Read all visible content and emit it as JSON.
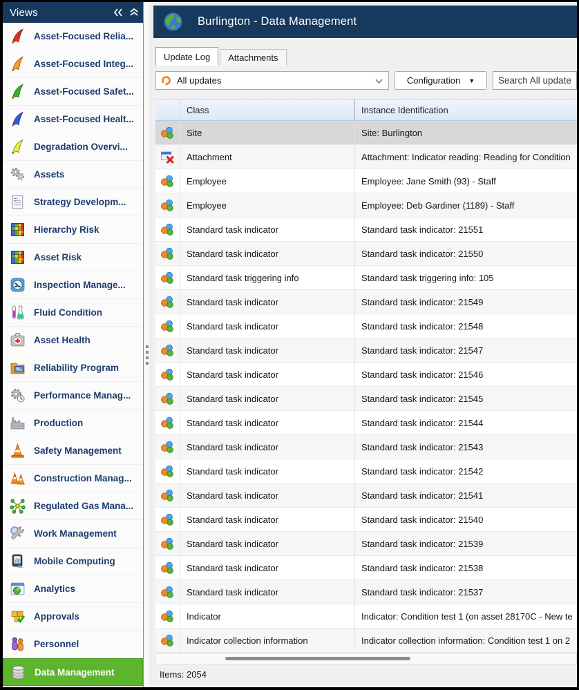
{
  "sidebar": {
    "header": {
      "title": "Views"
    },
    "items": [
      {
        "icon": "flag-red",
        "label": "Asset-Focused Relia...",
        "selected": false
      },
      {
        "icon": "flag-orange",
        "label": "Asset-Focused Integ...",
        "selected": false
      },
      {
        "icon": "flag-green",
        "label": "Asset-Focused Safet...",
        "selected": false
      },
      {
        "icon": "flag-blue",
        "label": "Asset-Focused Healt...",
        "selected": false
      },
      {
        "icon": "flag-yellow",
        "label": "Degradation Overvi...",
        "selected": false
      },
      {
        "icon": "gears",
        "label": "Assets",
        "selected": false
      },
      {
        "icon": "document",
        "label": "Strategy Developm...",
        "selected": false
      },
      {
        "icon": "risk-grid",
        "label": "Hierarchy Risk",
        "selected": false
      },
      {
        "icon": "risk-grid",
        "label": "Asset Risk",
        "selected": false
      },
      {
        "icon": "gauge",
        "label": "Inspection Manage...",
        "selected": false
      },
      {
        "icon": "test-tubes",
        "label": "Fluid Condition",
        "selected": false
      },
      {
        "icon": "first-aid",
        "label": "Asset Health",
        "selected": false
      },
      {
        "icon": "folder",
        "label": "Reliability Program",
        "selected": false
      },
      {
        "icon": "perf-gears",
        "label": "Performance Manag...",
        "selected": false
      },
      {
        "icon": "factory",
        "label": "Production",
        "selected": false
      },
      {
        "icon": "cone",
        "label": "Safety Management",
        "selected": false
      },
      {
        "icon": "cones",
        "label": "Construction Manag...",
        "selected": false
      },
      {
        "icon": "molecule",
        "label": "Regulated Gas Mana...",
        "selected": false
      },
      {
        "icon": "tools",
        "label": "Work Management",
        "selected": false
      },
      {
        "icon": "mobile",
        "label": "Mobile Computing",
        "selected": false
      },
      {
        "icon": "analytics",
        "label": "Analytics",
        "selected": false
      },
      {
        "icon": "approvals",
        "label": "Approvals",
        "selected": false
      },
      {
        "icon": "personnel",
        "label": "Personnel",
        "selected": false
      },
      {
        "icon": "database",
        "label": "Data Management",
        "selected": true
      }
    ]
  },
  "main": {
    "header": {
      "title": "Burlington - Data Management"
    },
    "tabs": [
      {
        "label": "Update Log",
        "active": true
      },
      {
        "label": "Attachments",
        "active": false
      }
    ],
    "toolbar": {
      "filter_value": "All updates",
      "configuration_label": "Configuration",
      "search_placeholder": "Search All updates"
    },
    "table": {
      "columns": [
        "Class",
        "Instance Identification"
      ],
      "rows": [
        {
          "icon": "class-balls",
          "class": "Site",
          "instance": "Site: Burlington",
          "selected": true
        },
        {
          "icon": "attachment",
          "class": "Attachment",
          "instance": "Attachment: Indicator reading: Reading for Condition",
          "selected": false
        },
        {
          "icon": "class-balls",
          "class": "Employee",
          "instance": "Employee: Jane Smith  (93) - Staff",
          "selected": false
        },
        {
          "icon": "class-balls",
          "class": "Employee",
          "instance": "Employee: Deb Gardiner  (1189) - Staff",
          "selected": false
        },
        {
          "icon": "class-balls",
          "class": "Standard task indicator",
          "instance": "Standard task indicator: 21551",
          "selected": false
        },
        {
          "icon": "class-balls",
          "class": "Standard task indicator",
          "instance": "Standard task indicator: 21550",
          "selected": false
        },
        {
          "icon": "class-balls",
          "class": "Standard task triggering info",
          "instance": "Standard task triggering info: 105",
          "selected": false
        },
        {
          "icon": "class-balls",
          "class": "Standard task indicator",
          "instance": "Standard task indicator: 21549",
          "selected": false
        },
        {
          "icon": "class-balls",
          "class": "Standard task indicator",
          "instance": "Standard task indicator: 21548",
          "selected": false
        },
        {
          "icon": "class-balls",
          "class": "Standard task indicator",
          "instance": "Standard task indicator: 21547",
          "selected": false
        },
        {
          "icon": "class-balls",
          "class": "Standard task indicator",
          "instance": "Standard task indicator: 21546",
          "selected": false
        },
        {
          "icon": "class-balls",
          "class": "Standard task indicator",
          "instance": "Standard task indicator: 21545",
          "selected": false
        },
        {
          "icon": "class-balls",
          "class": "Standard task indicator",
          "instance": "Standard task indicator: 21544",
          "selected": false
        },
        {
          "icon": "class-balls",
          "class": "Standard task indicator",
          "instance": "Standard task indicator: 21543",
          "selected": false
        },
        {
          "icon": "class-balls",
          "class": "Standard task indicator",
          "instance": "Standard task indicator: 21542",
          "selected": false
        },
        {
          "icon": "class-balls",
          "class": "Standard task indicator",
          "instance": "Standard task indicator: 21541",
          "selected": false
        },
        {
          "icon": "class-balls",
          "class": "Standard task indicator",
          "instance": "Standard task indicator: 21540",
          "selected": false
        },
        {
          "icon": "class-balls",
          "class": "Standard task indicator",
          "instance": "Standard task indicator: 21539",
          "selected": false
        },
        {
          "icon": "class-balls",
          "class": "Standard task indicator",
          "instance": "Standard task indicator: 21538",
          "selected": false
        },
        {
          "icon": "class-balls",
          "class": "Standard task indicator",
          "instance": "Standard task indicator: 21537",
          "selected": false
        },
        {
          "icon": "class-balls",
          "class": "Indicator",
          "instance": "Indicator: Condition test 1 (on asset 28170C - New te",
          "selected": false
        },
        {
          "icon": "class-balls",
          "class": "Indicator collection information",
          "instance": "Indicator collection information: Condition test 1  on 2",
          "selected": false
        }
      ]
    },
    "status": {
      "items_text": "Items: 2054"
    }
  }
}
